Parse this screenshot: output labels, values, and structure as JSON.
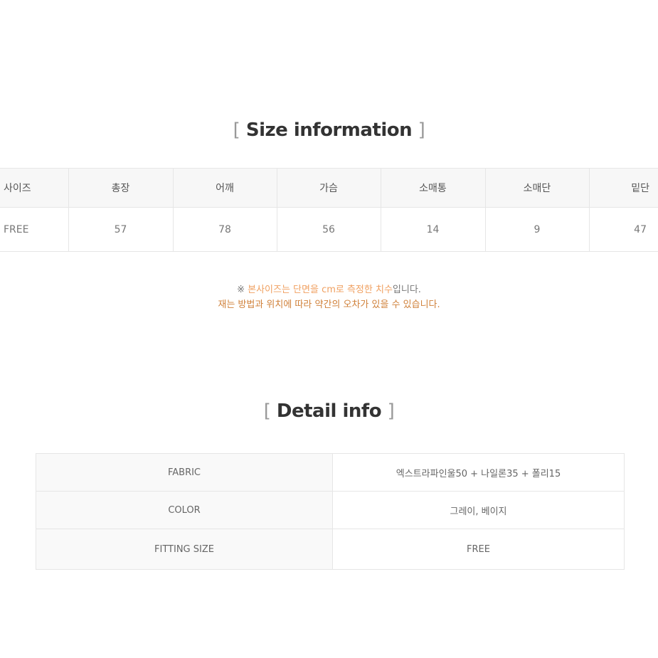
{
  "size_section": {
    "title": "Size information",
    "bracket_open": "[",
    "bracket_close": "]",
    "headers": [
      "사이즈",
      "총장",
      "어깨",
      "가슴",
      "소매통",
      "소매단",
      "밑단"
    ],
    "rows": [
      [
        "FREE",
        "57",
        "78",
        "56",
        "14",
        "9",
        "47"
      ]
    ]
  },
  "note": {
    "mark": "※",
    "line1_highlight": "본사이즈는 단면을 cm로 측정한 치수",
    "line1_tail": "입니다.",
    "line2": "재는 방법과 위치에 따라 약간의 오차가 있을 수 있습니다."
  },
  "detail_section": {
    "title": "Detail info",
    "bracket_open": "[",
    "bracket_close": "]",
    "rows": [
      {
        "label": "FABRIC",
        "value": "엑스트라파인울50 + 나일론35 + 폴리15"
      },
      {
        "label": "COLOR",
        "value": "그레이, 베이지"
      },
      {
        "label": "FITTING SIZE",
        "value": "FREE"
      }
    ]
  },
  "colors": {
    "note_highlight": "#f0a060",
    "note_line2": "#d0813a",
    "header_bg": "#f7f7f7",
    "border": "#e6e6e6"
  }
}
